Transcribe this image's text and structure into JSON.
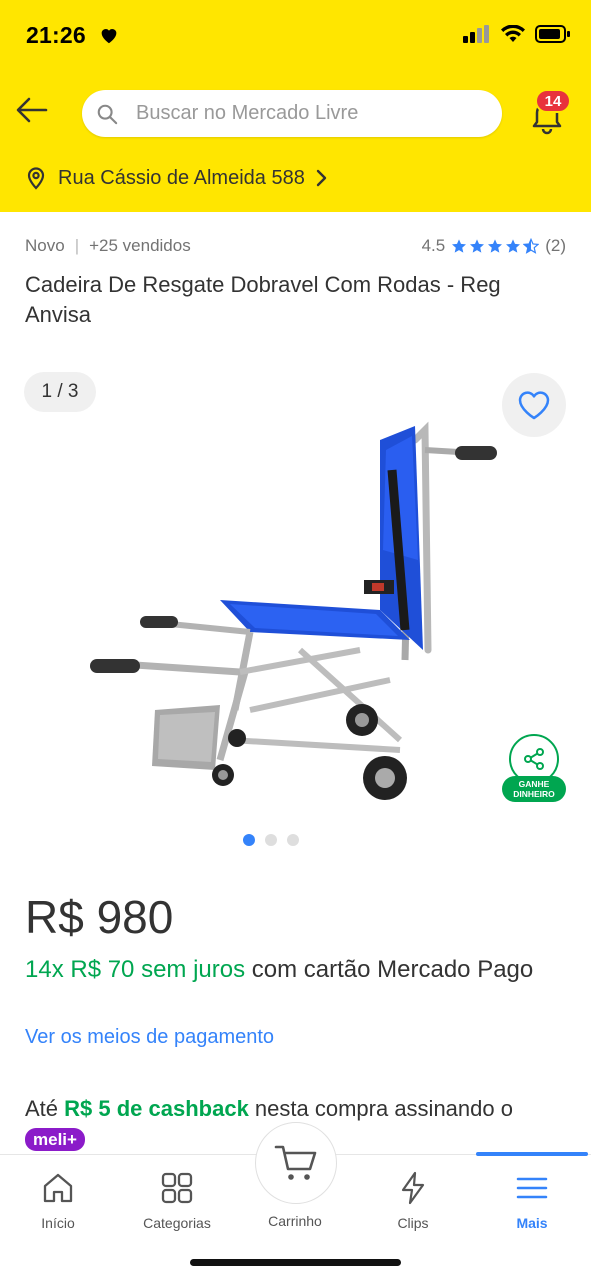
{
  "status_bar": {
    "time": "21:26"
  },
  "header": {
    "search_placeholder": "Buscar no Mercado Livre",
    "notification_count": "14",
    "address": "Rua Cássio de Almeida 588"
  },
  "product": {
    "condition": "Novo",
    "sold": "+25 vendidos",
    "rating_value": "4.5",
    "rating_count": "(2)",
    "rating_stars": 4.5,
    "title": "Cadeira De Resgate Dobravel Com Rodas - Reg Anvisa",
    "image_pager": "1 / 3",
    "image_count": 3,
    "current_image": 1,
    "share_label": "GANHE DINHEIRO",
    "price": "R$ 980",
    "installments_green": "14x R$ 70 sem juros",
    "installments_rest": " com cartão Mercado Pago",
    "payment_link": "Ver os meios de pagamento",
    "cashback_prefix": "Até ",
    "cashback_green": "R$ 5 de cashback",
    "cashback_suffix": " nesta compra assinando o ",
    "meli_badge": "meli+"
  },
  "tabbar": {
    "items": [
      {
        "label": "Início",
        "icon": "home-icon"
      },
      {
        "label": "Categorias",
        "icon": "grid-icon"
      },
      {
        "label": "Carrinho",
        "icon": "cart-icon"
      },
      {
        "label": "Clips",
        "icon": "lightning-icon"
      },
      {
        "label": "Mais",
        "icon": "menu-icon"
      }
    ],
    "active": "Mais"
  },
  "colors": {
    "brand_yellow": "#FFE600",
    "accent_blue": "#3483FA",
    "green": "#00A650",
    "badge_red": "#E8323C",
    "meli_purple": "#8B1BC9"
  }
}
